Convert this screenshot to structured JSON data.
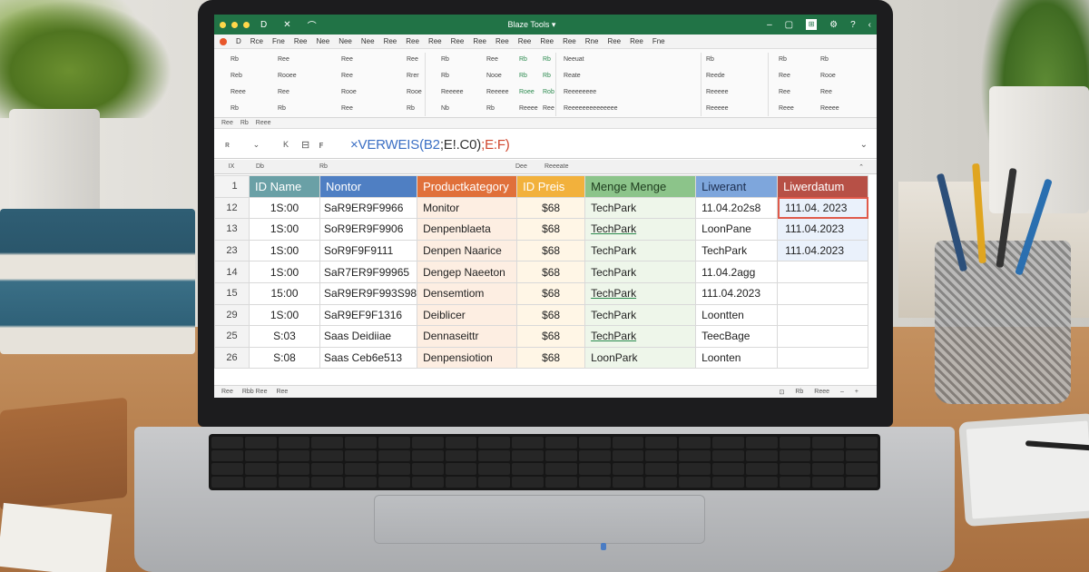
{
  "window": {
    "title": "Blaze Tools ▾",
    "quick_access": [
      "D",
      "✕",
      "⌒"
    ]
  },
  "ribbon_tabs": [
    "D",
    "Rce",
    "Fne",
    "Ree",
    "Nee",
    "Nee",
    "Nee",
    "Ree",
    "Ree",
    "Ree",
    "Ree",
    "Ree",
    "Ree",
    "Ree",
    "Ree",
    "Ree",
    "Rne",
    "Ree",
    "Ree",
    "Fne"
  ],
  "ribbon_rows": {
    "row1": [
      "Rb",
      "Ree",
      "Ree",
      "Ree",
      "Rb",
      "Ree",
      "Rb",
      "Rb",
      "Neeuat",
      "Rb",
      "Rb",
      "Rb"
    ],
    "row2": [
      "Reb",
      "Rooee",
      "Ree",
      "Rrer",
      "Rb",
      "Nooe",
      "Rb",
      "Rb",
      "Reate",
      "Reede",
      "Ree",
      "Rooe"
    ],
    "row3": [
      "Reee",
      "Ree",
      "Rooe",
      "Rooe",
      "Reeeee",
      "Reeeee",
      "Roee",
      "Rob",
      "Reeeeeeee",
      "Reeeee",
      "Ree",
      "Ree"
    ],
    "row4": [
      "Rb",
      "Rb",
      "Ree",
      "Rb",
      "Nb",
      "Rb",
      "Reeee",
      "Ree",
      "Reeeeeeeeeeeeee",
      "Reeeee",
      "Reee",
      "Reeee"
    ]
  },
  "subbar": [
    "Ree",
    "Rb",
    "Reee"
  ],
  "formula_bar": {
    "cell_ref": "fx",
    "formula_prefix": "×VERWEIS(",
    "formula_b2": "B2",
    "formula_mid": ";E!.C0)",
    "formula_end": ";E:F)"
  },
  "column_header_strip": [
    "IX",
    "Db",
    "Rb",
    "Dee",
    "Reeeate"
  ],
  "columns": [
    "ID Name",
    "Nontor",
    "Productkategory",
    "ID Preis",
    "Menge   Menge",
    "Liwerant",
    "Liwerdatum"
  ],
  "rows": [
    {
      "row": "12",
      "id": "1S:00",
      "name": "SaR9ER9F9966",
      "cat": "Monitor",
      "price": "$68",
      "menge": "TechPark",
      "lief": "11.04.2o2s8",
      "dat": "111.04. 2023"
    },
    {
      "row": "13",
      "id": "1S:00",
      "name": "SoR9ER9F9906",
      "cat": "Denpenblaeta",
      "price": "$68",
      "menge": "TechPark",
      "lief": "LoonPane",
      "dat": "111.04.2023"
    },
    {
      "row": "23",
      "id": "1S:00",
      "name": "SoR9F9F9111",
      "cat": "Denpen Naarice",
      "price": "$68",
      "menge": "TechPark",
      "lief": "TechPark",
      "dat": "111.04.2023"
    },
    {
      "row": "14",
      "id": "1S:00",
      "name": "SaR7ER9F99965",
      "cat": "Dengep Naeeton",
      "price": "$68",
      "menge": "TechPark",
      "lief": "11.04.2agg",
      "dat": ""
    },
    {
      "row": "15",
      "id": "15:00",
      "name": "SaR9ER9F993S98",
      "cat": "Densemtiom",
      "price": "$68",
      "menge": "TechPark",
      "lief": "111.04.2023",
      "dat": ""
    },
    {
      "row": "29",
      "id": "1S:00",
      "name": "SaR9EF9F1316",
      "cat": "Deiblicer",
      "price": "$68",
      "menge": "TechPark",
      "lief": "Loontten",
      "dat": ""
    },
    {
      "row": "25",
      "id": "S:03",
      "name": "Saas Deidiiae",
      "cat": "Dennaseittr",
      "price": "$68",
      "menge": "TechPark",
      "lief": "TeecBage",
      "dat": ""
    },
    {
      "row": "26",
      "id": "S:08",
      "name": "Saas Ceb6e513",
      "cat": "Denpensiotion",
      "price": "$68",
      "menge": "LoonPark",
      "lief": "Loonten",
      "dat": ""
    }
  ],
  "statusbar": [
    "Ree",
    "Rbb Ree",
    "Ree",
    "Rb",
    "Reee"
  ]
}
